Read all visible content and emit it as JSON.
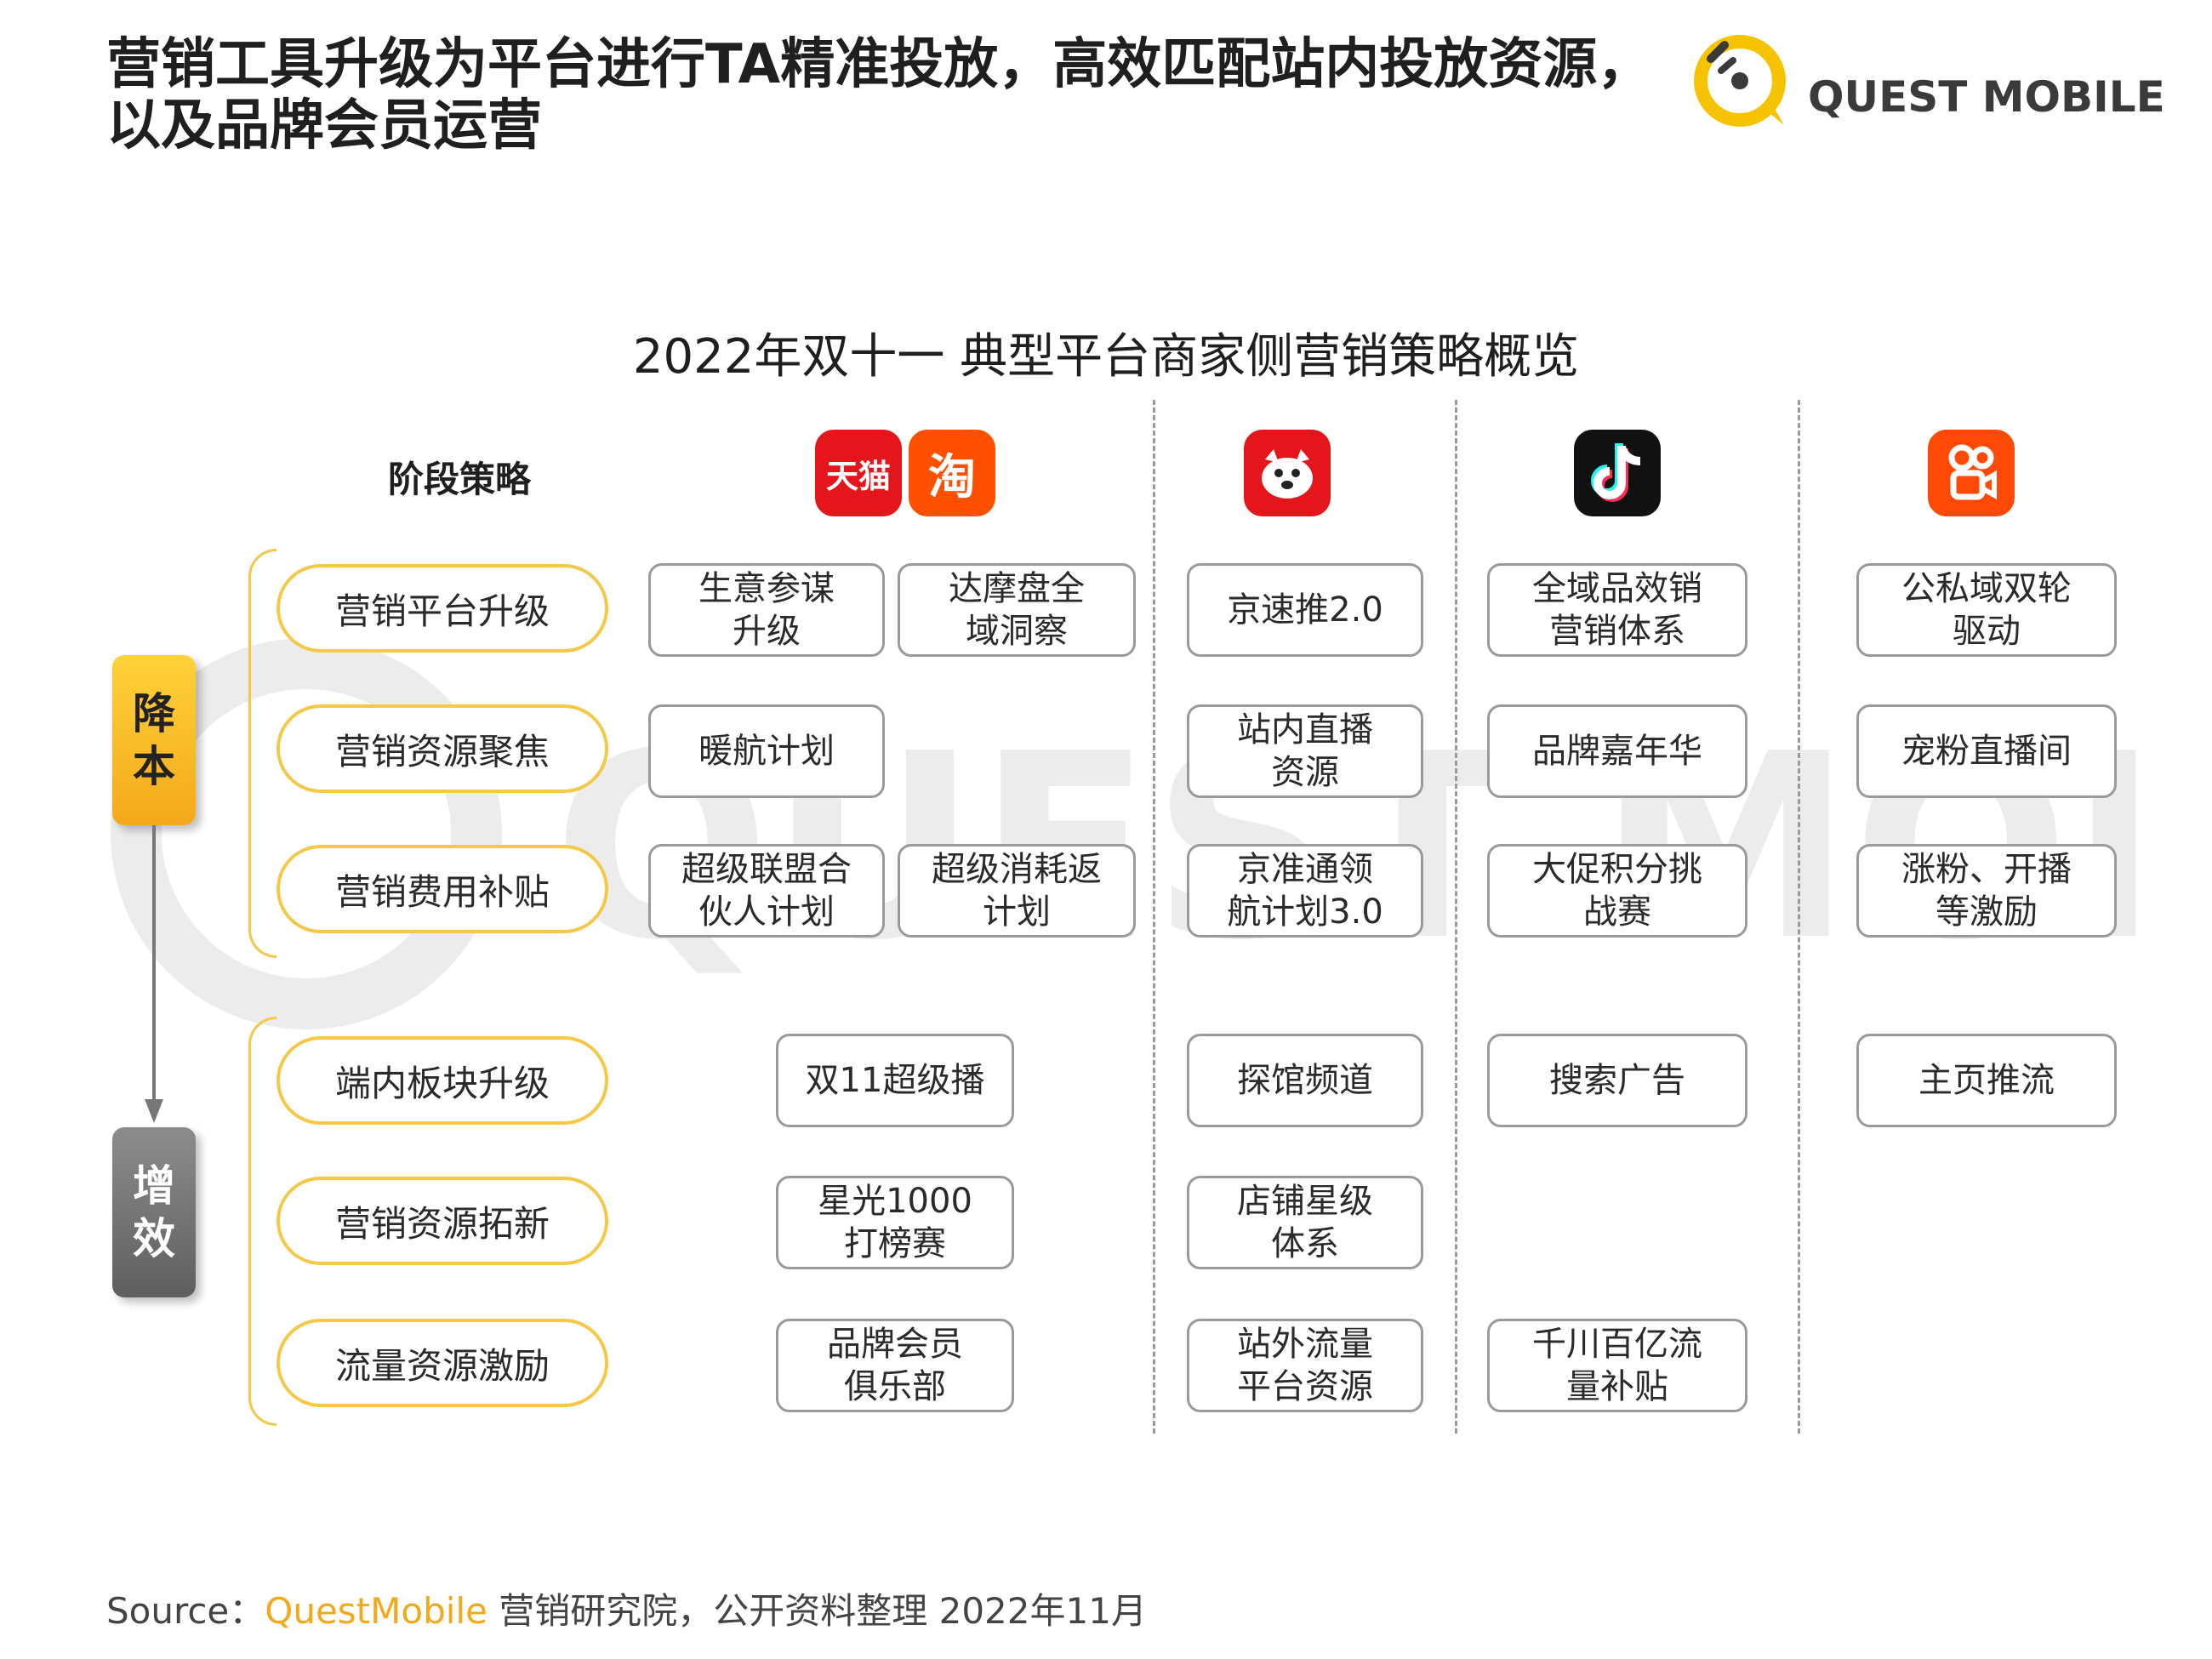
{
  "header": {
    "title_line1": "营销工具升级为平台进行TA精准投放，高效匹配站内投放资源，",
    "title_line2": "以及品牌会员运营",
    "logo_text": "QUEST MOBILE"
  },
  "chart_title": "2022年双十一 典型平台商家侧营销策略概览",
  "stage_header": "阶段策略",
  "badges": {
    "cost": "降本",
    "efficiency": "增效"
  },
  "platforms": [
    {
      "name": "天猫",
      "icon": "tmall-icon",
      "color": "#e4161c"
    },
    {
      "name": "淘",
      "icon": "taobao-icon",
      "color": "#ff5000"
    },
    {
      "name": "京东",
      "icon": "jd-icon",
      "color": "#e4161c"
    },
    {
      "name": "抖音",
      "icon": "douyin-icon",
      "color": "#111111"
    },
    {
      "name": "快手",
      "icon": "kuaishou-icon",
      "color": "#ff4906"
    }
  ],
  "stages": [
    "营销平台升级",
    "营销资源聚焦",
    "营销费用补贴",
    "端内板块升级",
    "营销资源拓新",
    "流量资源激励"
  ],
  "cells": {
    "ali_r1a": "生意参谋\n升级",
    "ali_r1b": "达摩盘全\n域洞察",
    "ali_r2a": "暖航计划",
    "ali_r3a": "超级联盟合\n伙人计划",
    "ali_r3b": "超级消耗返\n计划",
    "ali_r4": "双11超级播",
    "ali_r5": "星光1000\n打榜赛",
    "ali_r6": "品牌会员\n俱乐部",
    "jd_r1": "京速推2.0",
    "jd_r2": "站内直播\n资源",
    "jd_r3": "京准通领\n航计划3.0",
    "jd_r4": "探馆频道",
    "jd_r5": "店铺星级\n体系",
    "jd_r6": "站外流量\n平台资源",
    "dy_r1": "全域品效销\n营销体系",
    "dy_r2": "品牌嘉年华",
    "dy_r3": "大促积分挑\n战赛",
    "dy_r4": "搜索广告",
    "dy_r6": "千川百亿流\n量补贴",
    "ks_r1": "公私域双轮\n驱动",
    "ks_r2": "宠粉直播间",
    "ks_r3": "涨粉、开播\n等激励",
    "ks_r4": "主页推流"
  },
  "source": {
    "prefix": "Source：",
    "brand": "QuestMobile",
    "rest": " 营销研究院，公开资料整理 2022年11月"
  },
  "colors": {
    "accent_yellow": "#f5c84a",
    "brand_orange": "#f4a81b",
    "grey_border": "#9a9a9a"
  }
}
